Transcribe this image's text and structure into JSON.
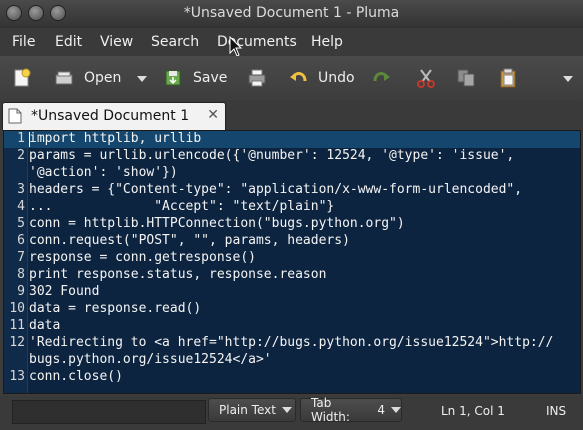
{
  "window": {
    "title": "*Unsaved Document 1 - Pluma"
  },
  "menu": [
    "File",
    "Edit",
    "View",
    "Search",
    "Documents",
    "Help"
  ],
  "toolbar": {
    "open_label": "Open",
    "save_label": "Save",
    "undo_label": "Undo"
  },
  "tab": {
    "label": "*Unsaved Document 1",
    "close": "✕"
  },
  "editor": {
    "lines": [
      {
        "n": "1",
        "text": "import httplib, urllib"
      },
      {
        "n": "2",
        "text": "params = urllib.urlencode({'@number': 12524, '@type': 'issue',"
      },
      {
        "n": "",
        "text": "'@action': 'show'})"
      },
      {
        "n": "3",
        "text": "headers = {\"Content-type\": \"application/x-www-form-urlencoded\","
      },
      {
        "n": "4",
        "text": "...             \"Accept\": \"text/plain\"}"
      },
      {
        "n": "5",
        "text": "conn = httplib.HTTPConnection(\"bugs.python.org\")"
      },
      {
        "n": "6",
        "text": "conn.request(\"POST\", \"\", params, headers)"
      },
      {
        "n": "7",
        "text": "response = conn.getresponse()"
      },
      {
        "n": "8",
        "text": "print response.status, response.reason"
      },
      {
        "n": "9",
        "text": "302 Found"
      },
      {
        "n": "10",
        "text": "data = response.read()"
      },
      {
        "n": "11",
        "text": "data"
      },
      {
        "n": "12",
        "text": "'Redirecting to <a href=\"http://bugs.python.org/issue12524\">http://"
      },
      {
        "n": "",
        "text": "bugs.python.org/issue12524</a>'"
      },
      {
        "n": "13",
        "text": "conn.close()"
      }
    ]
  },
  "status": {
    "language": "Plain Text",
    "tab_width_label": "Tab Width:",
    "tab_width_value": "4",
    "position": "Ln 1, Col 1",
    "mode": "INS"
  },
  "colors": {
    "editor_bg": "#0d2440",
    "current_line": "#14466e",
    "line_numbers": "#102a4a"
  }
}
